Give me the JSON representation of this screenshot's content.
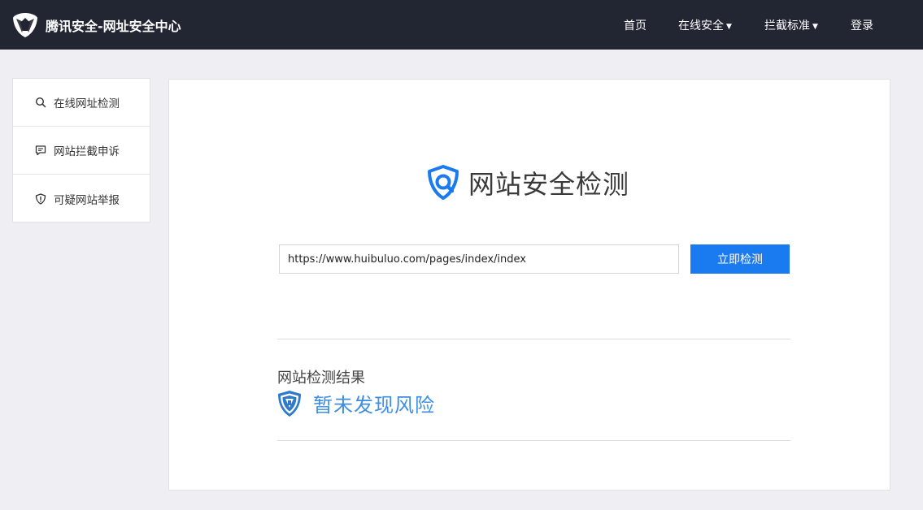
{
  "header": {
    "title": "腾讯安全-网址安全中心",
    "nav": [
      {
        "label": "首页",
        "has_dropdown": false
      },
      {
        "label": "在线安全",
        "has_dropdown": true
      },
      {
        "label": "拦截标准",
        "has_dropdown": true
      },
      {
        "label": "登录",
        "has_dropdown": false
      }
    ]
  },
  "sidebar": {
    "items": [
      {
        "label": "在线网址检测",
        "icon": "search-icon"
      },
      {
        "label": "网站拦截申诉",
        "icon": "chat-icon"
      },
      {
        "label": "可疑网站举报",
        "icon": "shield-alert-icon"
      }
    ]
  },
  "main": {
    "title": "网站安全检测",
    "url_value": "https://www.huibuluo.com/pages/index/index",
    "check_button_label": "立即检测",
    "result_label": "网站检测结果",
    "result_text": "暂未发现风险"
  },
  "colors": {
    "topbar": "#222532",
    "accent": "#1a7bf0",
    "result": "#3d8ee0"
  }
}
